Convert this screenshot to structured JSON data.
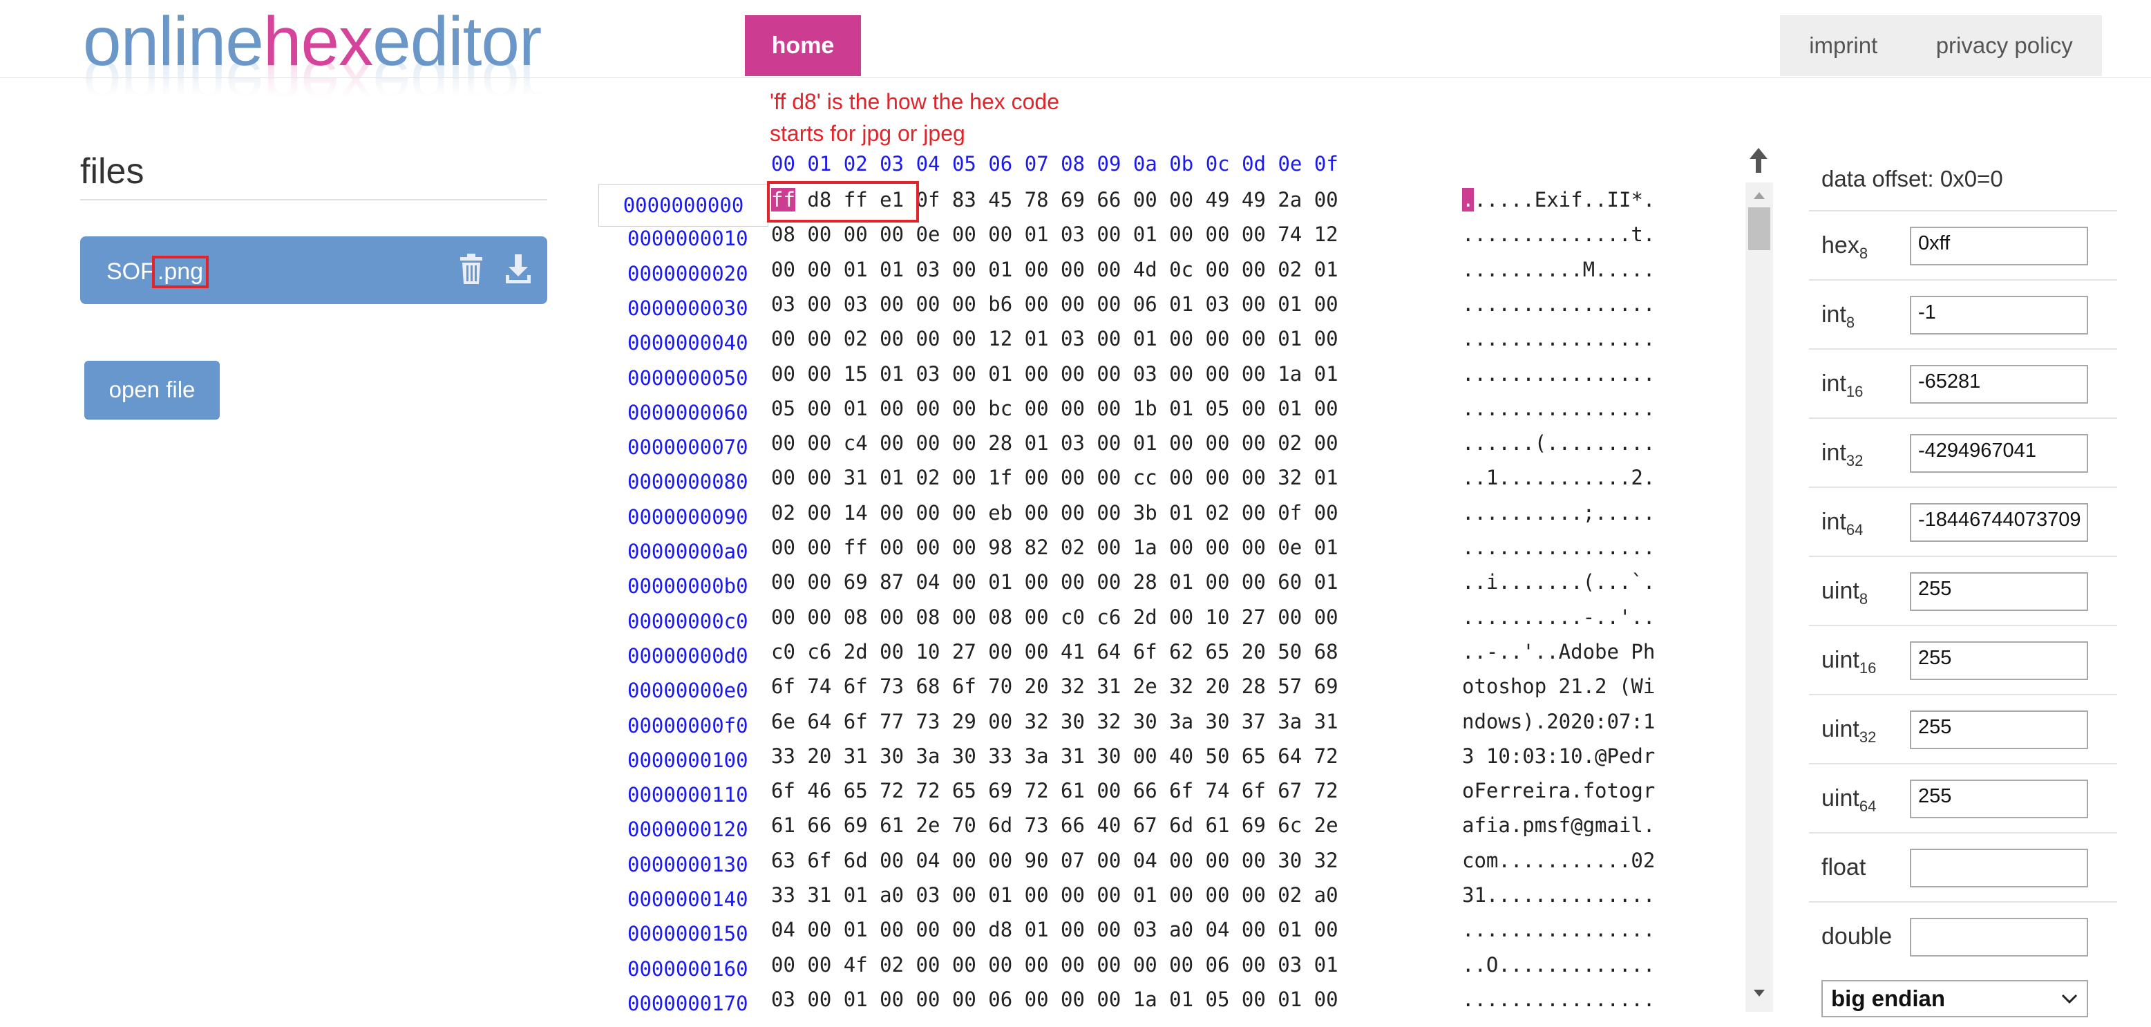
{
  "logo": {
    "part1": "online",
    "part2": "hex",
    "part3": "editor"
  },
  "nav": {
    "home": "home",
    "imprint": "imprint",
    "privacy": "privacy policy"
  },
  "files": {
    "title": "files",
    "items": [
      {
        "name_base": "SOF",
        "name_ext": ".png"
      }
    ],
    "open_button": "open file"
  },
  "annotation": {
    "line1": "'ff d8' is the how the hex code",
    "line2": "starts for jpg or jpeg"
  },
  "hex": {
    "column_headers": [
      "00",
      "01",
      "02",
      "03",
      "04",
      "05",
      "06",
      "07",
      "08",
      "09",
      "0a",
      "0b",
      "0c",
      "0d",
      "0e",
      "0f"
    ],
    "selected_offset": "0000000000",
    "rows": [
      {
        "offset": "0000000000",
        "first": "ff",
        "bytes": "d8 ff e1 0f 83 45 78 69 66 00 00 49 49 2a 00",
        "ascii_first": ".",
        "ascii": ".....Exif..II*."
      },
      {
        "offset": "0000000010",
        "bytes": "08 00 00 00 0e 00 00 01 03 00 01 00 00 00 74 12",
        "ascii": "..............t."
      },
      {
        "offset": "0000000020",
        "bytes": "00 00 01 01 03 00 01 00 00 00 4d 0c 00 00 02 01",
        "ascii": "..........M....."
      },
      {
        "offset": "0000000030",
        "bytes": "03 00 03 00 00 00 b6 00 00 00 06 01 03 00 01 00",
        "ascii": "................"
      },
      {
        "offset": "0000000040",
        "bytes": "00 00 02 00 00 00 12 01 03 00 01 00 00 00 01 00",
        "ascii": "................"
      },
      {
        "offset": "0000000050",
        "bytes": "00 00 15 01 03 00 01 00 00 00 03 00 00 00 1a 01",
        "ascii": "................"
      },
      {
        "offset": "0000000060",
        "bytes": "05 00 01 00 00 00 bc 00 00 00 1b 01 05 00 01 00",
        "ascii": "................"
      },
      {
        "offset": "0000000070",
        "bytes": "00 00 c4 00 00 00 28 01 03 00 01 00 00 00 02 00",
        "ascii": "......(........."
      },
      {
        "offset": "0000000080",
        "bytes": "00 00 31 01 02 00 1f 00 00 00 cc 00 00 00 32 01",
        "ascii": "..1...........2."
      },
      {
        "offset": "0000000090",
        "bytes": "02 00 14 00 00 00 eb 00 00 00 3b 01 02 00 0f 00",
        "ascii": "..........;....."
      },
      {
        "offset": "00000000a0",
        "bytes": "00 00 ff 00 00 00 98 82 02 00 1a 00 00 00 0e 01",
        "ascii": "................"
      },
      {
        "offset": "00000000b0",
        "bytes": "00 00 69 87 04 00 01 00 00 00 28 01 00 00 60 01",
        "ascii": "..i.......(...`."
      },
      {
        "offset": "00000000c0",
        "bytes": "00 00 08 00 08 00 08 00 c0 c6 2d 00 10 27 00 00",
        "ascii": "..........-..'.."
      },
      {
        "offset": "00000000d0",
        "bytes": "c0 c6 2d 00 10 27 00 00 41 64 6f 62 65 20 50 68",
        "ascii": "..-..'..Adobe Ph"
      },
      {
        "offset": "00000000e0",
        "bytes": "6f 74 6f 73 68 6f 70 20 32 31 2e 32 20 28 57 69",
        "ascii": "otoshop 21.2 (Wi"
      },
      {
        "offset": "00000000f0",
        "bytes": "6e 64 6f 77 73 29 00 32 30 32 30 3a 30 37 3a 31",
        "ascii": "ndows).2020:07:1"
      },
      {
        "offset": "0000000100",
        "bytes": "33 20 31 30 3a 30 33 3a 31 30 00 40 50 65 64 72",
        "ascii": "3 10:03:10.@Pedr"
      },
      {
        "offset": "0000000110",
        "bytes": "6f 46 65 72 72 65 69 72 61 00 66 6f 74 6f 67 72",
        "ascii": "oFerreira.fotogr"
      },
      {
        "offset": "0000000120",
        "bytes": "61 66 69 61 2e 70 6d 73 66 40 67 6d 61 69 6c 2e",
        "ascii": "afia.pmsf@gmail."
      },
      {
        "offset": "0000000130",
        "bytes": "63 6f 6d 00 04 00 00 90 07 00 04 00 00 00 30 32",
        "ascii": "com...........02"
      },
      {
        "offset": "0000000140",
        "bytes": "33 31 01 a0 03 00 01 00 00 00 01 00 00 00 02 a0",
        "ascii": "31.............."
      },
      {
        "offset": "0000000150",
        "bytes": "04 00 01 00 00 00 d8 01 00 00 03 a0 04 00 01 00",
        "ascii": "................"
      },
      {
        "offset": "0000000160",
        "bytes": "00 00 4f 02 00 00 00 00 00 00 00 00 06 00 03 01",
        "ascii": "..O............."
      },
      {
        "offset": "0000000170",
        "bytes": "03 00 01 00 00 00 06 00 00 00 1a 01 05 00 01 00",
        "ascii": "................"
      }
    ]
  },
  "inspector": {
    "offset_text": "data offset: 0x0=0",
    "rows": [
      {
        "name": "hex",
        "sub": "8",
        "value": "0xff"
      },
      {
        "name": "int",
        "sub": "8",
        "value": "-1"
      },
      {
        "name": "int",
        "sub": "16",
        "value": "-65281"
      },
      {
        "name": "int",
        "sub": "32",
        "value": "-4294967041"
      },
      {
        "name": "int",
        "sub": "64",
        "value": "-18446744073709"
      },
      {
        "name": "uint",
        "sub": "8",
        "value": "255"
      },
      {
        "name": "uint",
        "sub": "16",
        "value": "255"
      },
      {
        "name": "uint",
        "sub": "32",
        "value": "255"
      },
      {
        "name": "uint",
        "sub": "64",
        "value": "255"
      },
      {
        "name": "float",
        "sub": "",
        "value": ""
      },
      {
        "name": "double",
        "sub": "",
        "value": ""
      }
    ],
    "endian": "big endian"
  },
  "colors": {
    "accent": "#cc3d92",
    "brand_blue": "#6797cc",
    "annotation_red": "#e0242a",
    "offset_blue": "#1a1aee"
  }
}
